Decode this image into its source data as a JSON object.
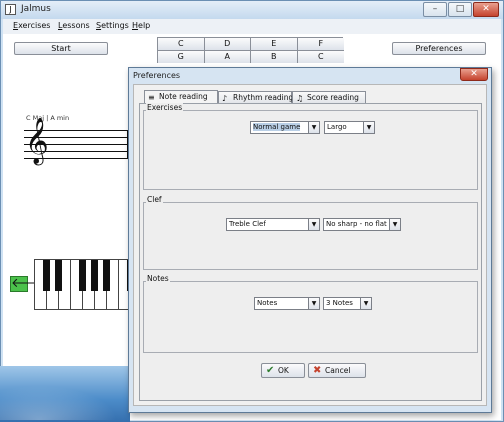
{
  "window": {
    "title": "Jalmus",
    "app_icon": "J"
  },
  "menubar": [
    "Exercises",
    "Lessons",
    "Settings",
    "Help"
  ],
  "toolbar": {
    "start_label": "Start",
    "preferences_label": "Preferences"
  },
  "note_buttons": {
    "row1": [
      "C",
      "D",
      "E",
      "F"
    ],
    "row2": [
      "G",
      "A",
      "B",
      "C"
    ]
  },
  "staff": {
    "key_label": "C Maj | A min",
    "clef_glyph": "𝄞"
  },
  "dialog": {
    "title": "Preferences",
    "close_glyph": "✕",
    "tabs": [
      "Note reading",
      "Rhythm reading",
      "Score reading"
    ],
    "sections": {
      "exercises": {
        "label": "Exercises",
        "game_value": "Normal game",
        "tempo_value": "Largo"
      },
      "clef": {
        "label": "Clef",
        "clef_value": "Treble Clef",
        "key_value": "No sharp - no flat"
      },
      "notes": {
        "label": "Notes",
        "notes_value": "Notes",
        "count_value": "3 Notes"
      }
    },
    "ok_label": "OK",
    "cancel_label": "Cancel"
  },
  "colors": {
    "accent_green": "#4bc14b",
    "close_red": "#c5432e",
    "selection_blue": "#b9cfe6"
  }
}
